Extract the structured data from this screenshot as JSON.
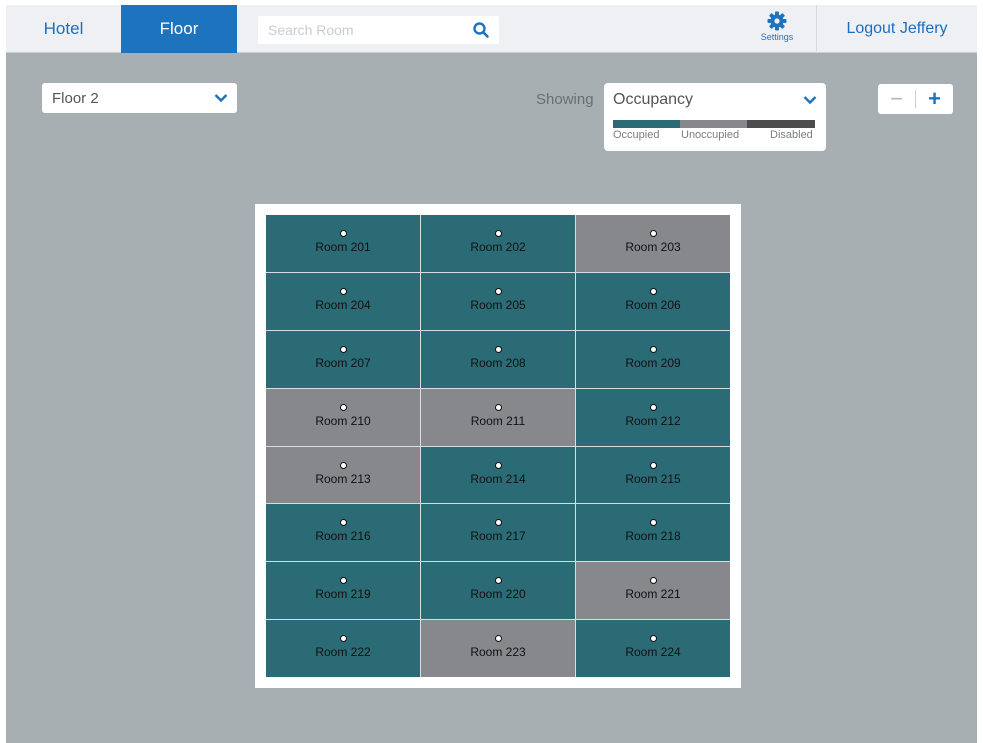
{
  "nav": {
    "hotel_label": "Hotel",
    "floor_label": "Floor",
    "search_placeholder": "Search Room",
    "settings_label": "Settings",
    "logout_label": "Logout Jeffery"
  },
  "floor_select": {
    "value": "Floor 2"
  },
  "showing": {
    "label": "Showing",
    "selected": "Occupancy",
    "legend": [
      {
        "label": "Occupied",
        "color": "#2b6b75"
      },
      {
        "label": "Unoccupied",
        "color": "#86888b"
      },
      {
        "label": "Disabled",
        "color": "#4b4c4e"
      }
    ]
  },
  "zoom": {
    "minus": "−",
    "plus": "+"
  },
  "colors": {
    "occupied": "#2b6b75",
    "unoccupied": "#86888b",
    "disabled": "#4b4c4e",
    "accent": "#1e73be"
  },
  "rooms": [
    {
      "name": "Room 201",
      "status": "occupied"
    },
    {
      "name": "Room 202",
      "status": "occupied"
    },
    {
      "name": "Room 203",
      "status": "unoccupied"
    },
    {
      "name": "Room 204",
      "status": "occupied"
    },
    {
      "name": "Room 205",
      "status": "occupied"
    },
    {
      "name": "Room 206",
      "status": "occupied"
    },
    {
      "name": "Room 207",
      "status": "occupied"
    },
    {
      "name": "Room 208",
      "status": "occupied"
    },
    {
      "name": "Room 209",
      "status": "occupied"
    },
    {
      "name": "Room 210",
      "status": "unoccupied"
    },
    {
      "name": "Room 211",
      "status": "unoccupied"
    },
    {
      "name": "Room 212",
      "status": "occupied"
    },
    {
      "name": "Room 213",
      "status": "unoccupied"
    },
    {
      "name": "Room 214",
      "status": "occupied"
    },
    {
      "name": "Room 215",
      "status": "occupied"
    },
    {
      "name": "Room 216",
      "status": "occupied"
    },
    {
      "name": "Room 217",
      "status": "occupied"
    },
    {
      "name": "Room 218",
      "status": "occupied"
    },
    {
      "name": "Room 219",
      "status": "occupied"
    },
    {
      "name": "Room 220",
      "status": "occupied"
    },
    {
      "name": "Room 221",
      "status": "unoccupied"
    },
    {
      "name": "Room 222",
      "status": "occupied"
    },
    {
      "name": "Room 223",
      "status": "unoccupied"
    },
    {
      "name": "Room 224",
      "status": "occupied"
    }
  ]
}
